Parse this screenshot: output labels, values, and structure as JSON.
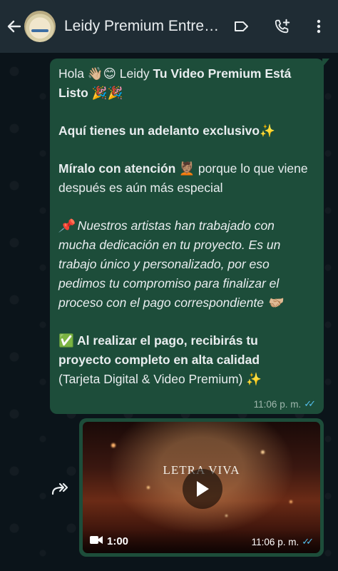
{
  "header": {
    "title": "Leidy Premium Entreg…",
    "icons": [
      "back-arrow-icon",
      "avatar",
      "label-icon",
      "add-call-icon",
      "more-vertical-icon"
    ]
  },
  "message": {
    "line1_prefix": "Hola 👋🏼😊 Leidy ",
    "line1_bold": "Tu Video Premium Está Listo 🎉🎉",
    "line2": "Aquí tienes un adelanto exclusivo✨",
    "line3_bold": "Míralo con atención",
    "line3_rest": " 💆🏽 porque lo que viene después es aún más especial",
    "line4": "📌 Nuestros artistas han trabajado con mucha dedicación en tu proyecto. Es un trabajo único y personalizado, por eso pedimos tu compromiso para finalizar el proceso con el pago correspondiente 🤝🏼",
    "line5_bold": "✅ Al realizar el pago, recibirás tu proyecto completo en alta calidad",
    "line5_rest": "(Tarjeta Digital & Video Premium) ✨",
    "time": "11:06 p. m."
  },
  "video": {
    "brand": "LETRA VIVA",
    "duration": "1:00",
    "time": "11:06 p. m."
  },
  "colors": {
    "header_bg": "#1f2c34",
    "bubble_bg": "#1d4d3a",
    "read_ticks": "#53bdeb"
  }
}
